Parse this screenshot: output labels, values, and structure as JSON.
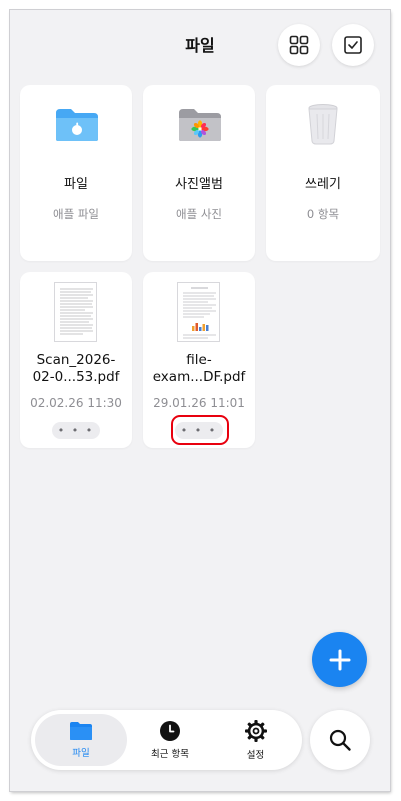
{
  "header": {
    "title": "파일"
  },
  "locations": [
    {
      "name": "파일",
      "subtitle": "애플 파일",
      "icon": "blue-folder-icon"
    },
    {
      "name": "사진앨범",
      "subtitle": "애플 사진",
      "icon": "photos-folder-icon"
    },
    {
      "name": "쓰레기",
      "subtitle": "0 항목",
      "icon": "trash-icon"
    }
  ],
  "documents": [
    {
      "name": "Scan_2026-\n02-0...53.pdf",
      "date": "02.02.26 11:30",
      "more": "• • •"
    },
    {
      "name": "file-\nexam...DF.pdf",
      "date": "29.01.26 11:01",
      "more": "• • •"
    }
  ],
  "tabbar": {
    "tabs": [
      {
        "label": "파일",
        "icon": "folder-icon",
        "active": true
      },
      {
        "label": "최근 항목",
        "icon": "clock-icon",
        "active": false
      },
      {
        "label": "설정",
        "icon": "gear-icon",
        "active": false
      }
    ]
  },
  "colors": {
    "accent": "#1a84f1",
    "highlight": "#e8000e",
    "background": "#f2f2f4"
  }
}
